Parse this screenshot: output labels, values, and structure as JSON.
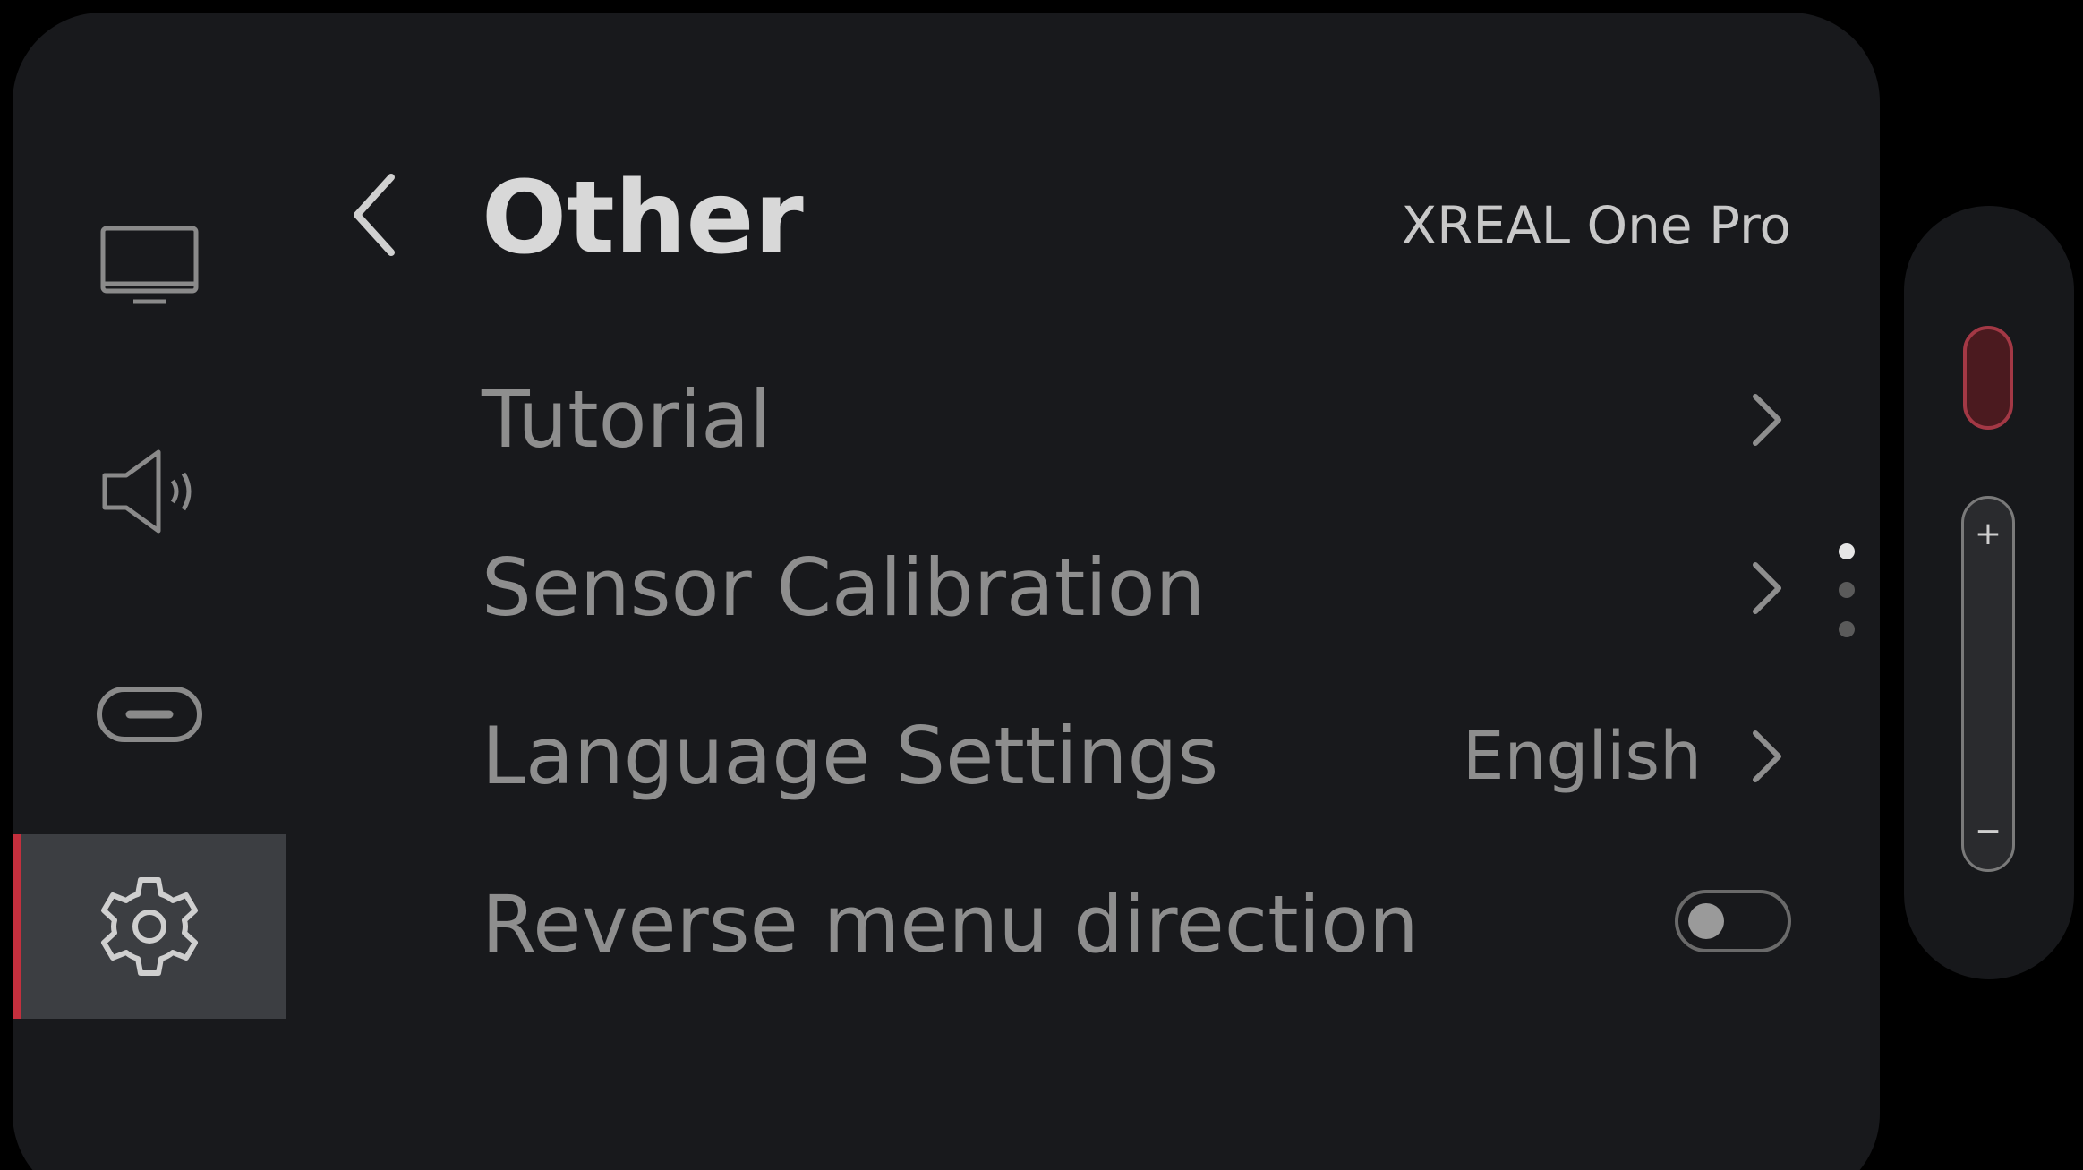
{
  "header": {
    "title": "Other",
    "device_name": "XREAL One Pro"
  },
  "sidebar": {
    "items": [
      {
        "name": "display",
        "icon": "monitor-icon",
        "active": false
      },
      {
        "name": "sound",
        "icon": "speaker-icon",
        "active": false
      },
      {
        "name": "button",
        "icon": "pill-button-icon",
        "active": false
      },
      {
        "name": "settings",
        "icon": "gear-icon",
        "active": true
      }
    ]
  },
  "menu": {
    "rows": [
      {
        "label": "Tutorial",
        "control": "chevron"
      },
      {
        "label": "Sensor Calibration",
        "control": "chevron"
      },
      {
        "label": "Language Settings",
        "value": "English",
        "control": "chevron"
      },
      {
        "label": "Reverse menu direction",
        "control": "toggle",
        "toggle_on": false
      }
    ]
  },
  "pagination": {
    "total": 3,
    "current": 1
  },
  "controller": {
    "plus": "+",
    "minus": "−"
  },
  "colors": {
    "background": "#000000",
    "panel": "#18191c",
    "active_item": "#3c3e42",
    "accent": "#c42f3d",
    "text_primary": "#d8d8d8",
    "text_secondary": "#8e8e8e"
  }
}
